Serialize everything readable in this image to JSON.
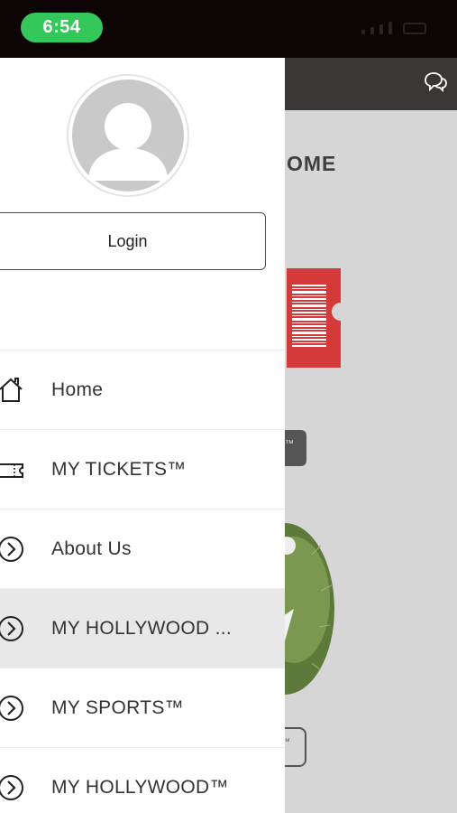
{
  "status_bar": {
    "time": "6:54"
  },
  "background_screen": {
    "title_fragment": "OME",
    "button_fragment": "™"
  },
  "drawer": {
    "login_label": "Login",
    "menu_items": [
      {
        "label": "Home",
        "icon": "home-icon",
        "active": false
      },
      {
        "label": "MY TICKETS™",
        "icon": "ticket-icon",
        "active": false
      },
      {
        "label": "About Us",
        "icon": "chevron-circle-right-icon",
        "active": false
      },
      {
        "label": "MY HOLLYWOOD ...",
        "icon": "chevron-circle-right-icon",
        "active": true
      },
      {
        "label": "MY SPORTS™",
        "icon": "chevron-circle-right-icon",
        "active": false
      },
      {
        "label": "MY HOLLYWOOD™",
        "icon": "chevron-circle-right-icon",
        "active": false
      }
    ]
  },
  "colors": {
    "status_pill": "#34c759",
    "ticket_red": "#d43a3a",
    "header_dark": "#3a3636"
  }
}
